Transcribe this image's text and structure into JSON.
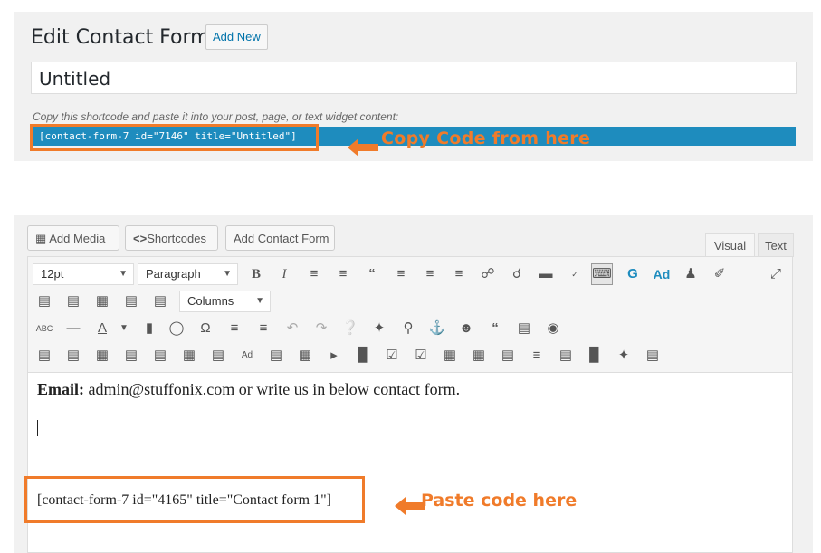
{
  "header": {
    "title": "Edit Contact Form",
    "add_new": "Add New"
  },
  "form": {
    "title_value": "Untitled",
    "shortcode_hint": "Copy this shortcode and paste it into your post, page, or text widget content:",
    "shortcode": "[contact-form-7 id=\"7146\" title=\"Untitled\"]"
  },
  "annotations": {
    "copy_label": "Copy Code from here",
    "paste_label": "Paste code here"
  },
  "media_buttons": {
    "add_media": "Add Media",
    "shortcodes": "Shortcodes",
    "add_contact_form": "Add Contact Form"
  },
  "tabs": {
    "visual": "Visual",
    "text": "Text"
  },
  "toolbar": {
    "font_size": "12pt",
    "format": "Paragraph",
    "columns": "Columns"
  },
  "content": {
    "email_label": "Email:",
    "email_text": " admin@stuffonix.com or write us in below contact form.",
    "pasted_code": "[contact-form-7 id=\"4165\" title=\"Contact form 1\"]"
  },
  "colors": {
    "accent": "#f07b2a",
    "shortcode_bg": "#1e8cbe",
    "link": "#0073aa"
  }
}
